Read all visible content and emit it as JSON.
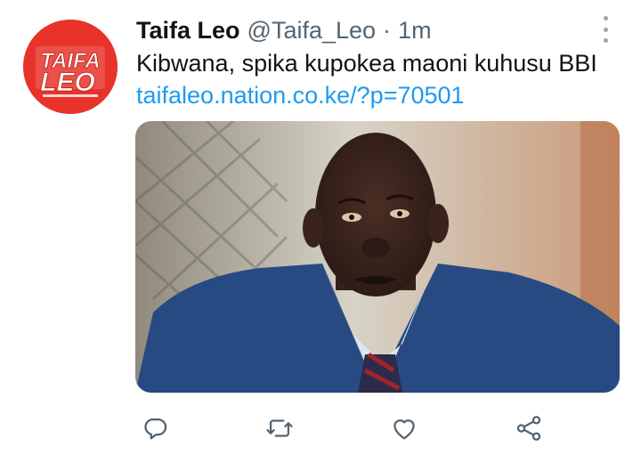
{
  "tweet": {
    "author_name": "Taifa Leo",
    "handle": "@Taifa_Leo",
    "separator": "·",
    "time": "1m",
    "text": "Kibwana, spika kupokea maoni kuhusu BBI",
    "link": "taifaleo.nation.co.ke/?p=70501"
  },
  "avatar": {
    "logo_line1": "TAIFA",
    "logo_line2": "LEO",
    "brand_color": "#e8332a"
  },
  "media": {
    "icon": "photo"
  },
  "actions": [
    {
      "icon": "reply-icon"
    },
    {
      "icon": "retweet-icon"
    },
    {
      "icon": "like-icon"
    },
    {
      "icon": "share-icon"
    }
  ],
  "colors": {
    "text": "#0f1419",
    "secondary": "#536471",
    "link": "#1d9bf0",
    "icon": "#536471"
  }
}
